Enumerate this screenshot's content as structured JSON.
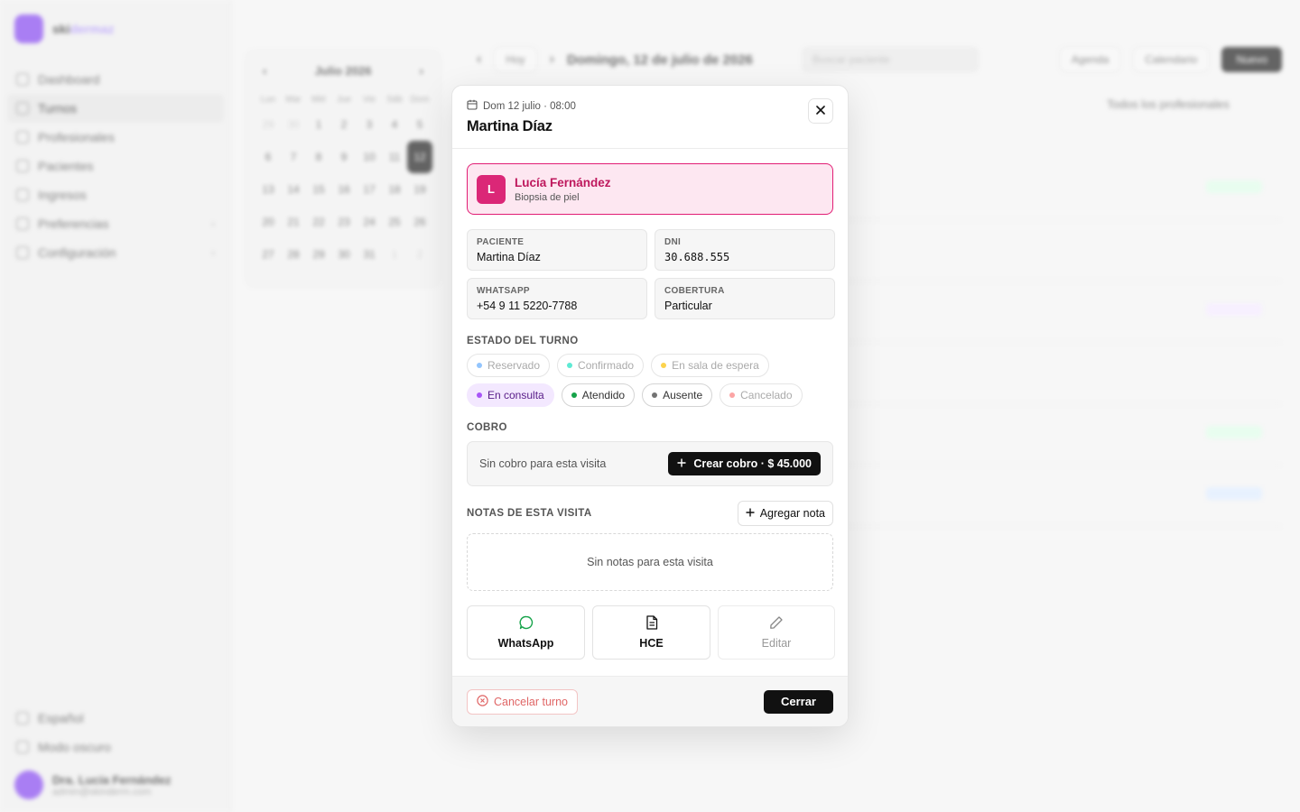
{
  "app": {
    "brand": {
      "name_a": "ski",
      "name_b": "dermaz"
    },
    "nav": [
      {
        "label": "Dashboard",
        "active": false
      },
      {
        "label": "Turnos",
        "active": true
      },
      {
        "label": "Profesionales",
        "active": false
      },
      {
        "label": "Pacientes",
        "active": false
      },
      {
        "label": "Ingresos",
        "active": false
      },
      {
        "label": "Preferencias",
        "active": false
      },
      {
        "label": "Configuración",
        "active": false
      }
    ],
    "footer_links": [
      {
        "label": "Español"
      },
      {
        "label": "Modo oscuro"
      }
    ],
    "user": {
      "name": "Dra. Lucía Fernández",
      "email": "admin@skinderm.com"
    }
  },
  "calendar": {
    "month_label": "Julio 2026",
    "dow": [
      "Lun",
      "Mar",
      "Mié",
      "Jue",
      "Vie",
      "Sáb",
      "Dom"
    ],
    "days": [
      "29",
      "30",
      "1",
      "2",
      "3",
      "4",
      "5",
      "6",
      "7",
      "8",
      "9",
      "10",
      "11",
      "12",
      "13",
      "14",
      "15",
      "16",
      "17",
      "18",
      "19",
      "20",
      "21",
      "22",
      "23",
      "24",
      "25",
      "26",
      "27",
      "28",
      "29",
      "30",
      "31",
      "1",
      "2"
    ],
    "selected": "12"
  },
  "topbar": {
    "today_label": "Hoy",
    "date_title": "Domingo, 12 de julio de 2026",
    "search_placeholder": "Buscar paciente",
    "view_agenda": "Agenda",
    "view_calendar": "Calendario",
    "new_button": "Nuevo",
    "professional_filter": "Todos los profesionales"
  },
  "modal": {
    "datetime": "Dom 12 julio · 08:00",
    "patient_title": "Martina Díaz",
    "professional": {
      "initial": "L",
      "name": "Lucía Fernández",
      "service": "Biopsia de piel"
    },
    "fields": {
      "paciente_label": "PACIENTE",
      "paciente_value": "Martina Díaz",
      "dni_label": "DNI",
      "dni_value": "30.688.555",
      "whatsapp_label": "WHATSAPP",
      "whatsapp_value": "+54 9 11 5220-7788",
      "cobertura_label": "COBERTURA",
      "cobertura_value": "Particular"
    },
    "status_label": "ESTADO DEL TURNO",
    "statuses": [
      {
        "label": "Reservado",
        "color": "#93c5fd",
        "state": "muted"
      },
      {
        "label": "Confirmado",
        "color": "#5eead4",
        "state": "muted"
      },
      {
        "label": "En sala de espera",
        "color": "#fcd34d",
        "state": "muted"
      },
      {
        "label": "En consulta",
        "color": "#a855f7",
        "state": "active"
      },
      {
        "label": "Atendido",
        "color": "#16a34a",
        "state": "strong"
      },
      {
        "label": "Ausente",
        "color": "#737373",
        "state": "strong"
      },
      {
        "label": "Cancelado",
        "color": "#fca5a5",
        "state": "muted"
      }
    ],
    "cobro_label": "COBRO",
    "cobro_empty": "Sin cobro para esta visita",
    "cobro_button": "Crear cobro · $ 45.000",
    "notes_label": "NOTAS DE ESTA VISITA",
    "notes_button": "Agregar nota",
    "notes_empty": "Sin notas para esta visita",
    "actions": {
      "whatsapp": "WhatsApp",
      "hce": "HCE",
      "edit": "Editar"
    },
    "footer": {
      "cancel": "Cancelar turno",
      "close": "Cerrar"
    }
  }
}
